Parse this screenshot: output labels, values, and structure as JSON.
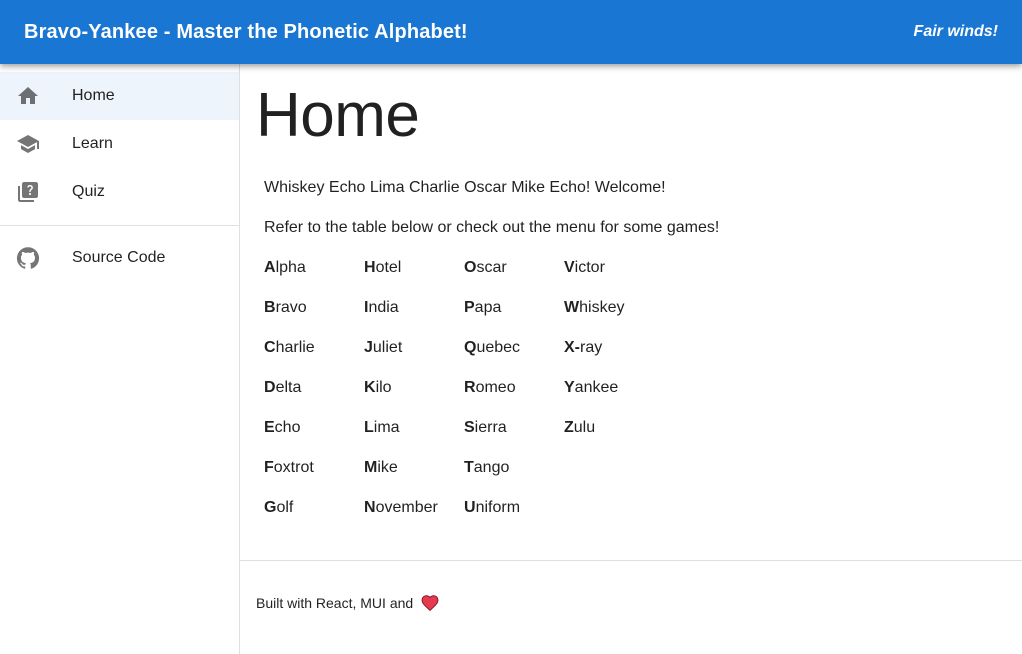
{
  "appbar": {
    "title": "Bravo-Yankee - Master the Phonetic Alphabet!",
    "tagline": "Fair winds!",
    "color": "#1976d2"
  },
  "nav": {
    "items": [
      {
        "label": "Home",
        "icon": "home-icon",
        "active": true
      },
      {
        "label": "Learn",
        "icon": "school-icon",
        "active": false
      },
      {
        "label": "Quiz",
        "icon": "quiz-icon",
        "active": false
      }
    ],
    "secondary": [
      {
        "label": "Source Code",
        "icon": "github-icon"
      }
    ]
  },
  "main": {
    "title": "Home",
    "welcome": "Whiskey Echo Lima Charlie Oscar Mike Echo! Welcome!",
    "intro": "Refer to the table below or check out the menu for some games!"
  },
  "alphabet": [
    {
      "initial": "A",
      "rest": "lpha"
    },
    {
      "initial": "B",
      "rest": "ravo"
    },
    {
      "initial": "C",
      "rest": "harlie"
    },
    {
      "initial": "D",
      "rest": "elta"
    },
    {
      "initial": "E",
      "rest": "cho"
    },
    {
      "initial": "F",
      "rest": "oxtrot"
    },
    {
      "initial": "G",
      "rest": "olf"
    },
    {
      "initial": "H",
      "rest": "otel"
    },
    {
      "initial": "I",
      "rest": "ndia"
    },
    {
      "initial": "J",
      "rest": "uliet"
    },
    {
      "initial": "K",
      "rest": "ilo"
    },
    {
      "initial": "L",
      "rest": "ima"
    },
    {
      "initial": "M",
      "rest": "ike"
    },
    {
      "initial": "N",
      "rest": "ovember"
    },
    {
      "initial": "O",
      "rest": "scar"
    },
    {
      "initial": "P",
      "rest": "apa"
    },
    {
      "initial": "Q",
      "rest": "uebec"
    },
    {
      "initial": "R",
      "rest": "omeo"
    },
    {
      "initial": "S",
      "rest": "ierra"
    },
    {
      "initial": "T",
      "rest": "ango"
    },
    {
      "initial": "U",
      "rest": "niform"
    },
    {
      "initial": "V",
      "rest": "ictor"
    },
    {
      "initial": "W",
      "rest": "hiskey"
    },
    {
      "initial": "X-",
      "rest": "ray"
    },
    {
      "initial": "Y",
      "rest": "ankee"
    },
    {
      "initial": "Z",
      "rest": "ulu"
    }
  ],
  "footer": {
    "text": "Built with React, MUI and",
    "icon": "heart-icon"
  }
}
